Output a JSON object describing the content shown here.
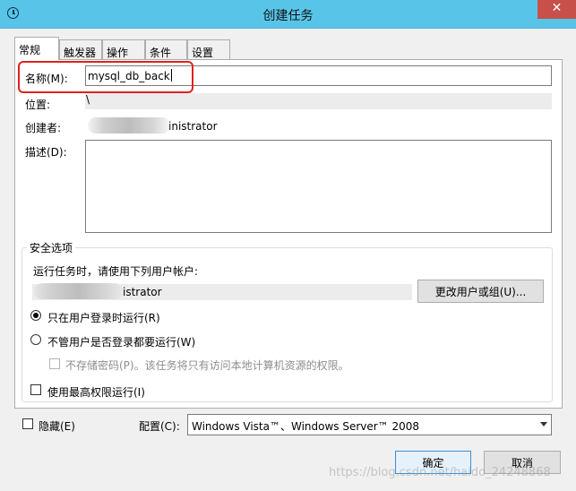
{
  "window": {
    "title": "创建任务",
    "close_glyph": "✕"
  },
  "tabs": [
    {
      "label": "常规",
      "active": true
    },
    {
      "label": "触发器"
    },
    {
      "label": "操作"
    },
    {
      "label": "条件"
    },
    {
      "label": "设置"
    }
  ],
  "general": {
    "name_label": "名称(M):",
    "name_value": "mysql_db_back",
    "location_label": "位置:",
    "location_value": "\\",
    "author_label": "创建者:",
    "author_value": "inistrator",
    "description_label": "描述(D):",
    "description_value": ""
  },
  "security": {
    "group_label": "安全选项",
    "run_as_prompt": "运行任务时，请使用下列用户帐户:",
    "user_account": "istrator",
    "change_user_button": "更改用户或组(U)...",
    "option_logged_on": "只在用户登录时运行(R)",
    "option_logged_on_checked": true,
    "option_whether_logged_on": "不管用户是否登录都要运行(W)",
    "option_whether_logged_on_checked": false,
    "do_not_store_password": "不存储密码(P)。该任务将只有访问本地计算机资源的权限。",
    "highest_privileges": "使用最高权限运行(I)"
  },
  "footer": {
    "hidden_label": "隐藏(E)",
    "configure_label": "配置(C):",
    "configure_value": "Windows Vista™、Windows Server™ 2008",
    "ok_button": "确定",
    "cancel_button": "取消"
  },
  "watermark": "https://blog.csdn.net/haido_24248868",
  "colors": {
    "titlebar": "#58c5e8",
    "close_button": "#c7504b",
    "highlight": "#e02020"
  }
}
